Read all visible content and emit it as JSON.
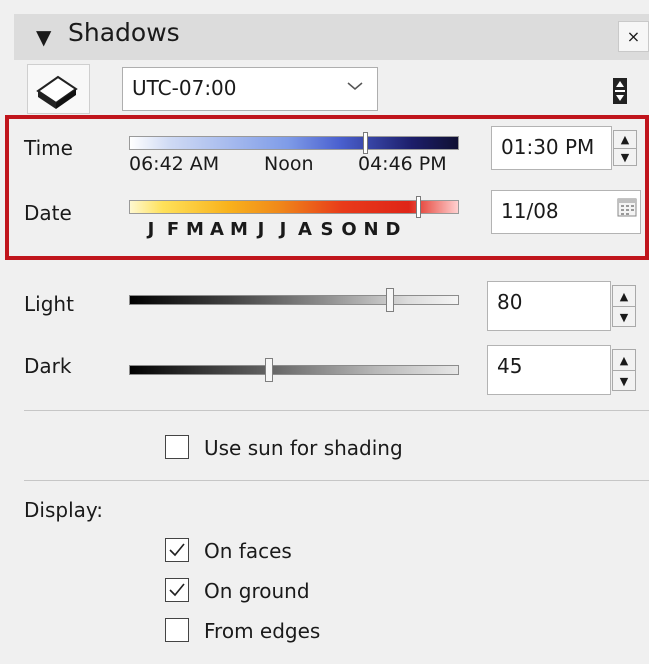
{
  "panel": {
    "title": "Shadows",
    "close_label": "×",
    "collapse_arrow": "▼"
  },
  "toolbar": {
    "timezone": "UTC-07:00",
    "toggle_icon": "shadow-toggle-icon",
    "collapse_icon": "panel-collapse-icon"
  },
  "time": {
    "label": "Time",
    "sunrise": "06:42 AM",
    "noon": "Noon",
    "sunset": "04:46 PM",
    "value": "01:30 PM",
    "slider_fraction": 0.71
  },
  "date": {
    "label": "Date",
    "months": [
      "J",
      "F",
      "M",
      "A",
      "M",
      "J",
      "J",
      "A",
      "S",
      "O",
      "N",
      "D"
    ],
    "value": "11/08",
    "slider_fraction": 0.87
  },
  "light": {
    "label": "Light",
    "value": "80"
  },
  "dark": {
    "label": "Dark",
    "value": "45"
  },
  "options": {
    "use_sun_label": "Use sun for shading",
    "use_sun_checked": false
  },
  "display": {
    "label": "Display:",
    "items": [
      {
        "label": "On faces",
        "checked": true
      },
      {
        "label": "On ground",
        "checked": true
      },
      {
        "label": "From edges",
        "checked": false
      }
    ]
  },
  "colors": {
    "highlight": "#c0151c"
  }
}
